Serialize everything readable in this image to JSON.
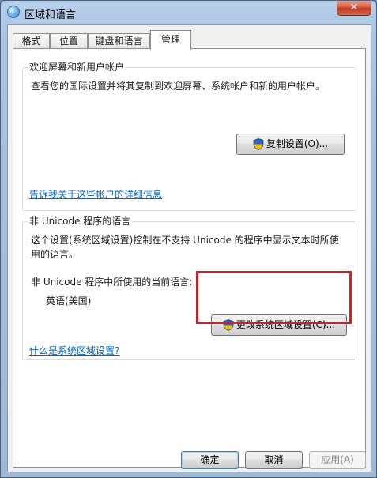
{
  "window": {
    "title": "区域和语言",
    "close_glyph": "✕"
  },
  "tabs": [
    {
      "label": "格式"
    },
    {
      "label": "位置"
    },
    {
      "label": "键盘和语言"
    },
    {
      "label": "管理",
      "active": true
    }
  ],
  "welcome_group": {
    "title": "欢迎屏幕和新用户帐户",
    "description": "查看您的国际设置并将其复制到欢迎屏幕、系统帐户和新的用户帐户。",
    "copy_button": "复制设置(O)...",
    "link": "告诉我关于这些帐户的详细信息"
  },
  "unicode_group": {
    "title": "非 Unicode 程序的语言",
    "description": "这个设置(系统区域设置)控制在不支持 Unicode 的程序中显示文本时所使用的语言。",
    "current_label": "非 Unicode 程序中所使用的当前语言:",
    "current_value": "英语(美国)",
    "change_button": "更改系统区域设置(C)...",
    "link": "什么是系统区域设置?"
  },
  "footer": {
    "ok": "确定",
    "cancel": "取消",
    "apply": "应用(A)"
  },
  "icons": {
    "window": "globe-icon",
    "shield": "uac-shield-icon"
  },
  "colors": {
    "link": "#0066cc",
    "highlight": "#c0262c"
  }
}
